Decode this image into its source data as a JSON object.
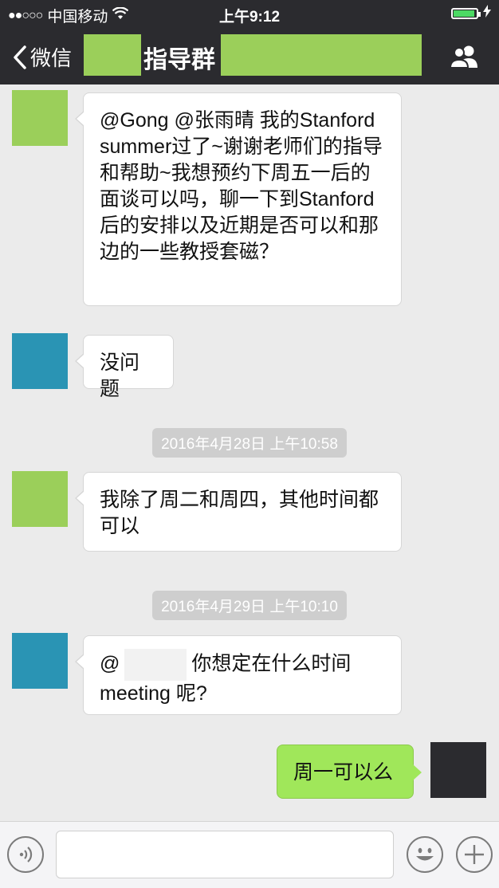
{
  "status_bar": {
    "signal": "●●○○○",
    "carrier": "中国移动",
    "time": "上午9:12"
  },
  "nav": {
    "back_label": "微信",
    "title": "指导群"
  },
  "messages": [
    {
      "side": "left",
      "avatar_color": "#9bcf5a",
      "text": "@Gong @张雨晴 我的Stanford summer过了~谢谢老师们的指导和帮助~我想预约下周五一后的面谈可以吗，聊一下到Stanford后的安排以及近期是否可以和那边的一些教授套磁？"
    },
    {
      "side": "left",
      "avatar_color": "#2a94b4",
      "text": "没问题"
    },
    {
      "timestamp": "2016年4月28日 上午10:58"
    },
    {
      "side": "left",
      "avatar_color": "#9bcf5a",
      "text": "我除了周二和周四，其他时间都可以"
    },
    {
      "timestamp": "2016年4月29日 上午10:10"
    },
    {
      "side": "left",
      "avatar_color": "#2a94b4",
      "prefix": "@",
      "text": "你想定在什么时间meeting 呢?"
    },
    {
      "side": "right",
      "avatar_color": "#2b2b2f",
      "text": "周一可以么"
    }
  ],
  "input": {
    "value": ""
  },
  "colors": {
    "bar_dark": "#2b2b2f",
    "bubble_green": "#a0e75a",
    "background": "#ebebeb"
  },
  "icons": [
    "signal-icon",
    "wifi-icon",
    "battery-icon",
    "charging-icon",
    "back-chevron-icon",
    "group-members-icon",
    "voice-icon",
    "emoji-icon",
    "plus-icon"
  ]
}
